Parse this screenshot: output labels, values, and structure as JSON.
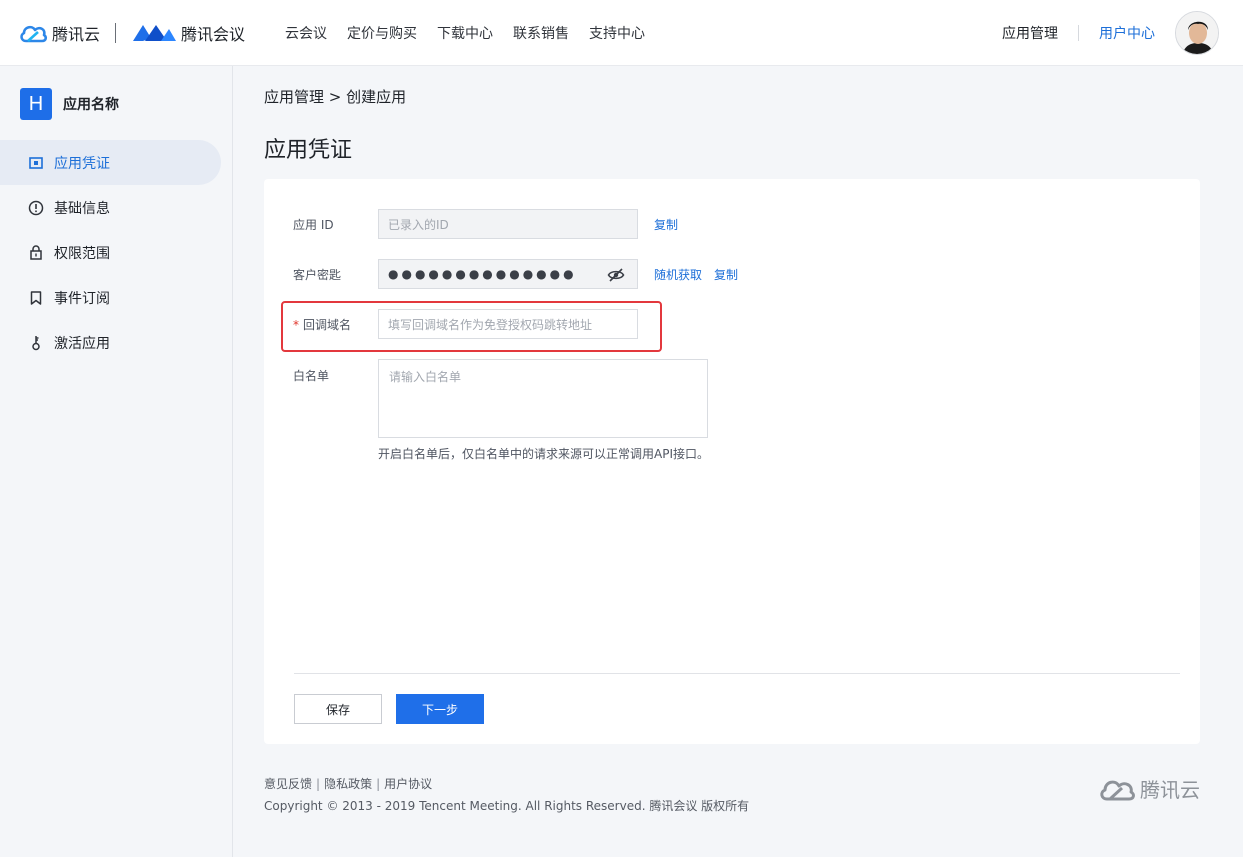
{
  "header": {
    "brand_cloud": "腾讯云",
    "brand_meeting": "腾讯会议",
    "nav": [
      "云会议",
      "定价与购买",
      "下载中心",
      "联系销售",
      "支持中心"
    ],
    "app_manage": "应用管理",
    "user_center": "用户中心"
  },
  "sidebar": {
    "app_badge": "H",
    "app_name": "应用名称",
    "items": [
      {
        "label": "应用凭证",
        "icon": "credential-icon",
        "active": true
      },
      {
        "label": "基础信息",
        "icon": "info-icon",
        "active": false
      },
      {
        "label": "权限范围",
        "icon": "lock-icon",
        "active": false
      },
      {
        "label": "事件订阅",
        "icon": "bookmark-icon",
        "active": false
      },
      {
        "label": "激活应用",
        "icon": "key-icon",
        "active": false
      }
    ]
  },
  "main": {
    "breadcrumb": "应用管理 > 创建应用",
    "title": "应用凭证",
    "form": {
      "app_id_label": "应用 ID",
      "app_id_placeholder": "已录入的ID",
      "copy": "复制",
      "secret_label": "客户密匙",
      "secret_value": "●●●●●●●●●●●●●●",
      "random_get": "随机获取",
      "callback_required": "*",
      "callback_label": "回调域名",
      "callback_placeholder": "填写回调域名作为免登授权码跳转地址",
      "whitelist_label": "白名单",
      "whitelist_placeholder": "请输入白名单",
      "whitelist_hint": "开启白名单后，仅白名单中的请求来源可以正常调用API接口。"
    },
    "buttons": {
      "save": "保存",
      "next": "下一步"
    }
  },
  "footer": {
    "links": [
      "意见反馈",
      "隐私政策",
      "用户协议"
    ],
    "link_separator": "|",
    "copyright": "Copyright © 2013 - 2019 Tencent Meeting. All Rights Reserved.  腾讯会议 版权所有",
    "brand": "腾讯云"
  },
  "colors": {
    "accent": "#1d6fd8",
    "primary_button": "#1f6fe9",
    "highlight_border": "#e3383d"
  }
}
